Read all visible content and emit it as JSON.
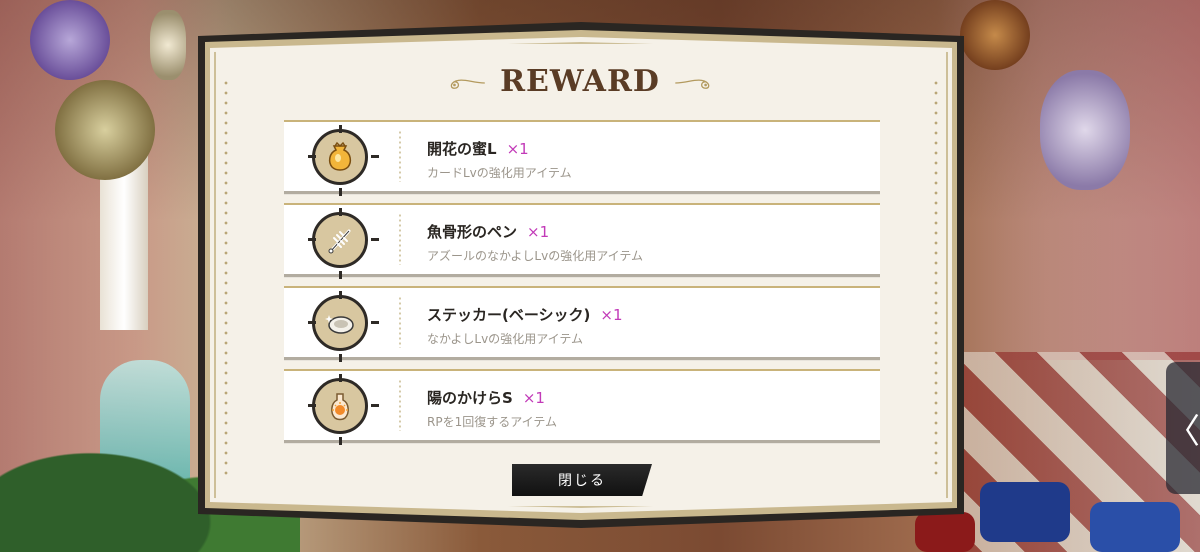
{
  "dialog": {
    "title": "REWARD",
    "close_label": "閉じる"
  },
  "rewards": [
    {
      "name": "開花の蜜L",
      "qty": "×1",
      "desc": "カードLvの強化用アイテム",
      "icon": "honey-jar-icon"
    },
    {
      "name": "魚骨形のペン",
      "qty": "×1",
      "desc": "アズールのなかよしLvの強化用アイテム",
      "icon": "fishbone-pen-icon"
    },
    {
      "name": "ステッカー(ベーシック)",
      "qty": "×1",
      "desc": "なかよしLvの強化用アイテム",
      "icon": "sticker-icon"
    },
    {
      "name": "陽のかけらS",
      "qty": "×1",
      "desc": "RPを1回復するアイテム",
      "icon": "sun-fragment-bottle-icon"
    }
  ],
  "side_nav": {
    "icon": "chevron-left-icon",
    "glyph": "〈"
  },
  "colors": {
    "quantity": "#c23ab8",
    "title": "#5a3c25",
    "frame_gold": "#c9b88e",
    "button": "#111111"
  }
}
